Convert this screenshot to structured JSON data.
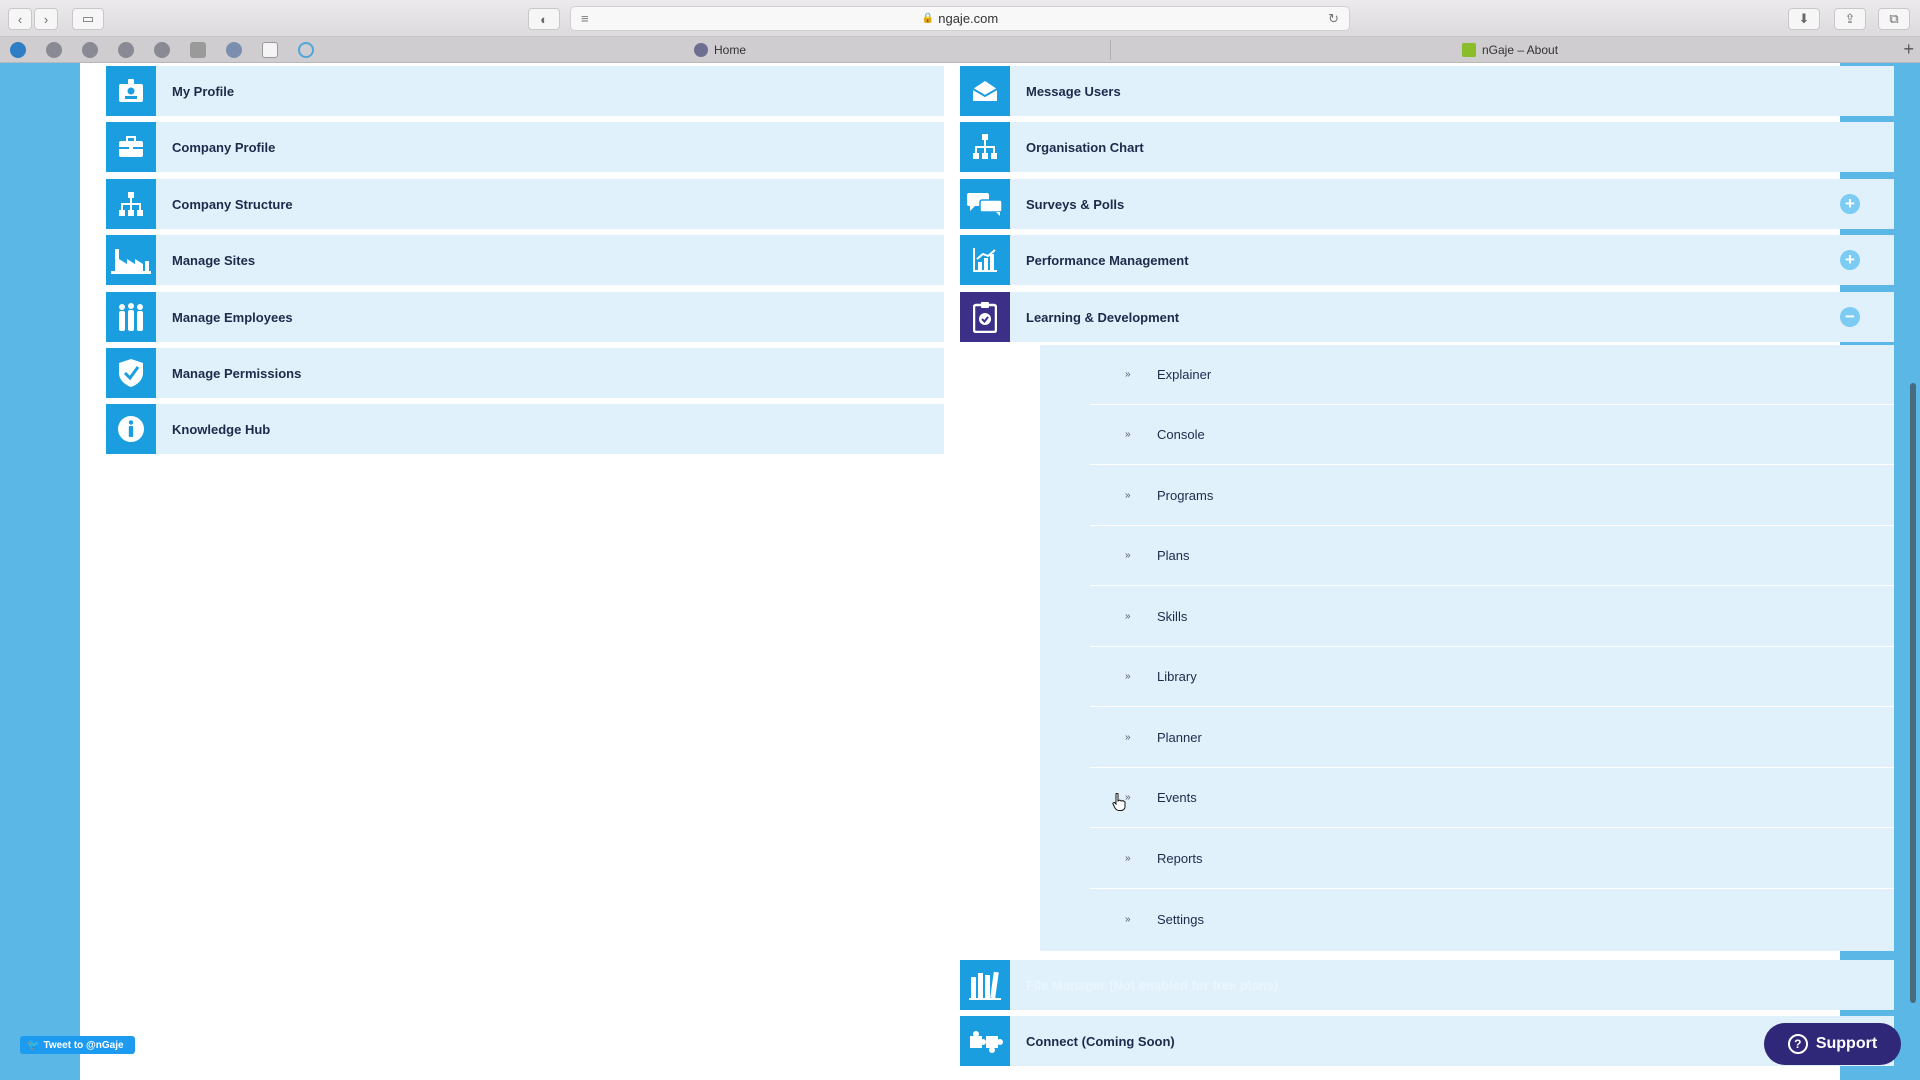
{
  "browser": {
    "url": "ngaje.com",
    "tabs": [
      {
        "label": "Home"
      },
      {
        "label": "nGaje – About"
      }
    ],
    "new_tab_symbol": "+"
  },
  "left_menu": [
    {
      "label": "My Profile",
      "icon": "id-card-icon"
    },
    {
      "label": "Company Profile",
      "icon": "briefcase-icon"
    },
    {
      "label": "Company Structure",
      "icon": "hierarchy-icon"
    },
    {
      "label": "Manage Sites",
      "icon": "factory-icon"
    },
    {
      "label": "Manage Employees",
      "icon": "people-icon"
    },
    {
      "label": "Manage Permissions",
      "icon": "shield-check-icon"
    },
    {
      "label": "Knowledge Hub",
      "icon": "info-icon"
    }
  ],
  "right_menu": [
    {
      "label": "Message Users",
      "icon": "envelope-icon"
    },
    {
      "label": "Organisation Chart",
      "icon": "org-chart-icon"
    },
    {
      "label": "Surveys & Polls",
      "icon": "chat-bubbles-icon",
      "toggle": "+"
    },
    {
      "label": "Performance Management",
      "icon": "bar-chart-icon",
      "toggle": "+"
    },
    {
      "label": "Learning & Development",
      "icon": "clipboard-check-icon",
      "toggle": "−",
      "expanded": true
    }
  ],
  "learning_submenu": {
    "bullet": "»",
    "items": [
      "Explainer",
      "Console",
      "Programs",
      "Plans",
      "Skills",
      "Library",
      "Planner",
      "Events",
      "Reports",
      "Settings"
    ]
  },
  "lower_right_menu": [
    {
      "label": "File Manager (Not enabled for free plans)",
      "icon": "books-icon"
    },
    {
      "label": "Connect (Coming Soon)",
      "icon": "puzzle-icon"
    }
  ],
  "footer": {
    "tweet_label": "Tweet to @nGaje",
    "support_label": "Support",
    "support_icon_glyph": "?"
  },
  "colors": {
    "background": "#5ab7e6",
    "row": "#e0f1fc",
    "icon_tile": "#1a9ee0",
    "active_tile": "#3b2f87",
    "support_button": "#2f2879"
  }
}
